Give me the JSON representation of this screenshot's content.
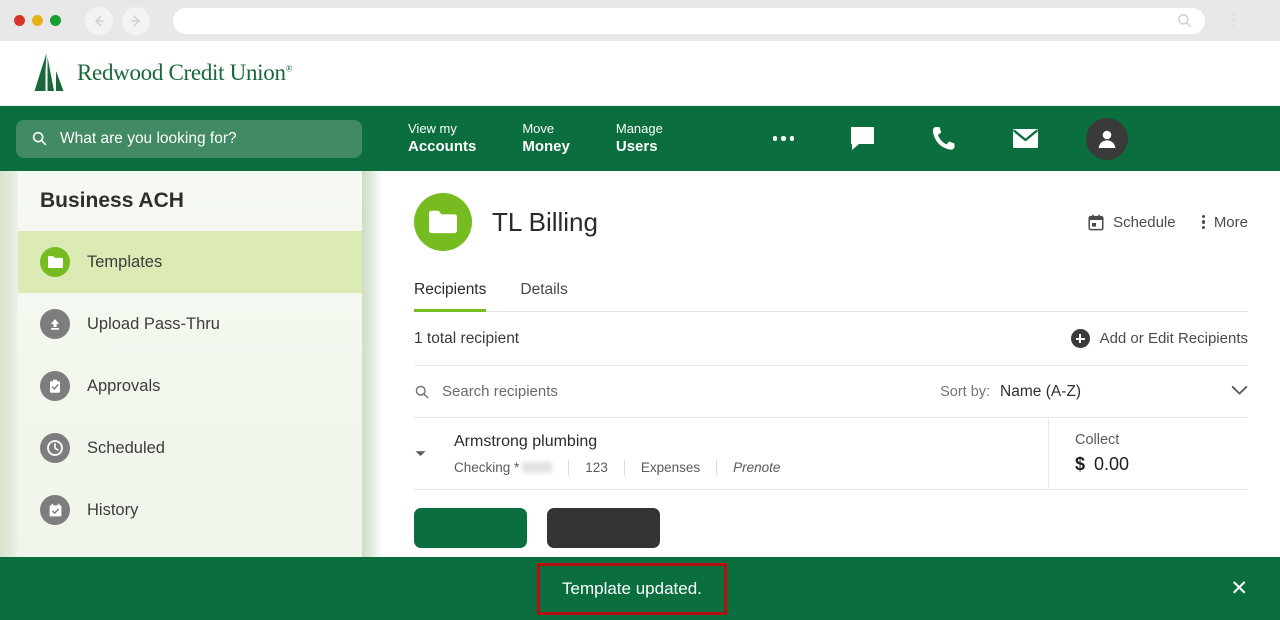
{
  "browser": {
    "back_icon": "back-arrow-icon",
    "forward_icon": "forward-arrow-icon",
    "url_value": "",
    "url_search_icon": "search-icon",
    "menu_icon": "kebab-menu-icon"
  },
  "brand": {
    "name": "Redwood Credit Union",
    "trademark": "®",
    "logo_icon": "redwood-tree-logo-icon"
  },
  "nav": {
    "search_placeholder": "What are you looking for?",
    "search_icon": "search-icon",
    "links": [
      {
        "top": "View my",
        "bottom": "Accounts"
      },
      {
        "top": "Move",
        "bottom": "Money"
      },
      {
        "top": "Manage",
        "bottom": "Users"
      }
    ],
    "more_icon": "ellipsis-icon",
    "chat_icon": "chat-bubble-icon",
    "phone_icon": "phone-icon",
    "mail_icon": "envelope-icon",
    "profile_icon": "user-avatar-icon"
  },
  "sidebar": {
    "title": "Business ACH",
    "items": [
      {
        "label": "Templates",
        "icon": "folder-icon",
        "active": true
      },
      {
        "label": "Upload Pass-Thru",
        "icon": "upload-icon",
        "active": false
      },
      {
        "label": "Approvals",
        "icon": "clipboard-check-icon",
        "active": false
      },
      {
        "label": "Scheduled",
        "icon": "clock-icon",
        "active": false
      },
      {
        "label": "History",
        "icon": "calendar-check-icon",
        "active": false
      }
    ]
  },
  "main": {
    "template_icon": "folder-icon",
    "template_name": "TL Billing",
    "schedule_label": "Schedule",
    "schedule_icon": "calendar-icon",
    "more_label": "More",
    "more_icon": "kebab-menu-icon",
    "tabs": [
      {
        "label": "Recipients",
        "active": true
      },
      {
        "label": "Details",
        "active": false
      }
    ],
    "recipient_count": "1 total recipient",
    "add_edit_label": "Add or Edit Recipients",
    "add_edit_icon": "plus-circle-icon",
    "search_placeholder": "Search recipients",
    "search_icon": "search-icon",
    "sort_label": "Sort by:",
    "sort_value": "Name (A-Z)",
    "sort_chevron_icon": "chevron-down-icon",
    "recipients": [
      {
        "expand_icon": "caret-down-icon",
        "name": "Armstrong plumbing",
        "account_type": "Checking *",
        "account_masked": "",
        "id_number": "123",
        "category": "Expenses",
        "status": "Prenote",
        "amount_label": "Collect",
        "amount_currency": "$",
        "amount_value": "0.00"
      }
    ],
    "buttons": [
      {
        "label": "",
        "style": "primary"
      },
      {
        "label": "",
        "style": "dark"
      }
    ]
  },
  "toast": {
    "message": "Template updated.",
    "close_icon": "close-icon",
    "highlight_color": "#b31111",
    "background_color": "#0a6e3f"
  }
}
